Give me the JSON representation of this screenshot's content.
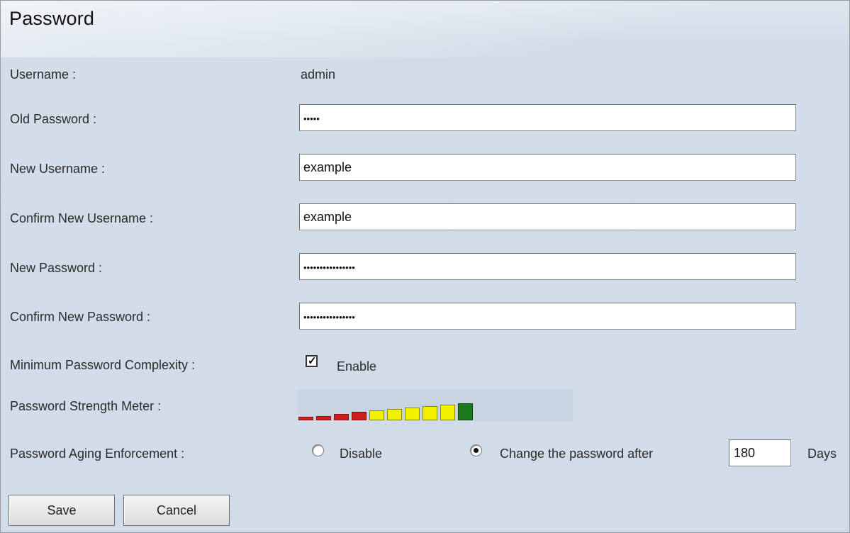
{
  "page": {
    "title": "Password"
  },
  "form": {
    "username": {
      "label": "Username :",
      "value": "admin"
    },
    "old_password": {
      "label": "Old Password :",
      "value": "•••••"
    },
    "new_username": {
      "label": "New Username :",
      "value": "example"
    },
    "confirm_new_username": {
      "label": "Confirm New Username :",
      "value": "example"
    },
    "new_password": {
      "label": "New Password :",
      "value": "••••••••••••••••"
    },
    "confirm_new_password": {
      "label": "Confirm New Password :",
      "value": "••••••••••••••••"
    },
    "min_complexity": {
      "label": "Minimum Password Complexity :",
      "option_label": "Enable",
      "checked": true
    },
    "strength_meter": {
      "label": "Password Strength Meter :",
      "segments_filled": 10,
      "segments_total": 10,
      "colors": {
        "weak": "#cc1e1e",
        "medium": "#f2f200",
        "strong": "#1e7a1e"
      }
    },
    "aging": {
      "label": "Password Aging Enforcement :",
      "disable_label": "Disable",
      "change_label": "Change the password after",
      "days_value": "180",
      "days_unit": "Days",
      "selected": "change"
    }
  },
  "buttons": {
    "save": "Save",
    "cancel": "Cancel"
  }
}
